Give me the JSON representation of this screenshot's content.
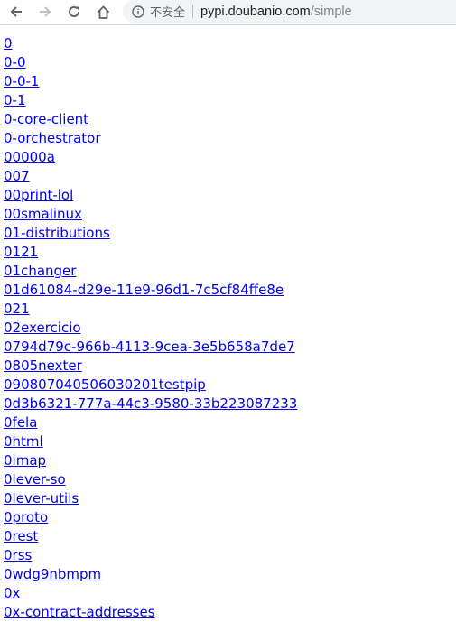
{
  "toolbar": {
    "security_label": "不安全",
    "url_host": "pypi.doubanio.com",
    "url_path": "/simple",
    "icons": [
      "back-arrow-icon",
      "forward-arrow-icon",
      "reload-icon",
      "home-icon",
      "info-icon"
    ]
  },
  "colors": {
    "link": "#0000ee",
    "omnibox_bg": "#f1f3f4"
  },
  "packages": [
    "0",
    "0-0",
    "0-0-1",
    "0-1",
    "0-core-client",
    "0-orchestrator",
    "00000a",
    "007",
    "00print-lol",
    "00smalinux",
    "01-distributions",
    "0121",
    "01changer",
    "01d61084-d29e-11e9-96d1-7c5cf84ffe8e",
    "021",
    "02exercicio",
    "0794d79c-966b-4113-9cea-3e5b658a7de7",
    "0805nexter",
    "090807040506030201testpip",
    "0d3b6321-777a-44c3-9580-33b223087233",
    "0fela",
    "0html",
    "0imap",
    "0lever-so",
    "0lever-utils",
    "0proto",
    "0rest",
    "0rss",
    "0wdg9nbmpm",
    "0x",
    "0x-contract-addresses"
  ]
}
